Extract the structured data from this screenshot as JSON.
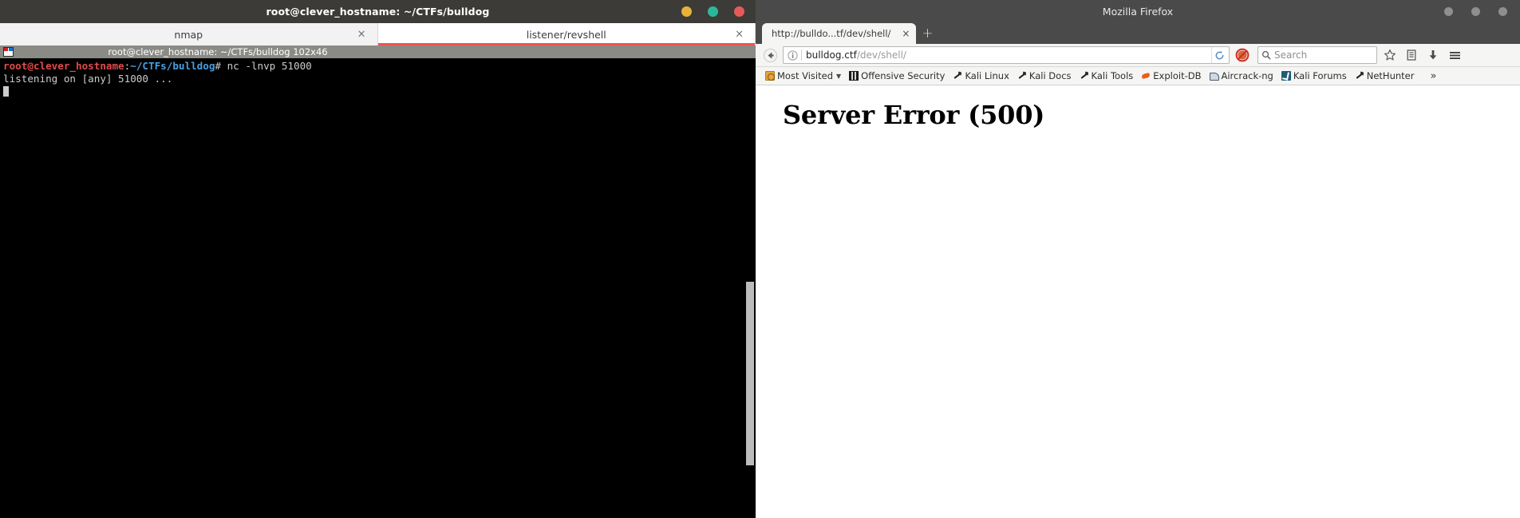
{
  "terminal": {
    "window_title": "root@clever_hostname: ~/CTFs/bulldog",
    "window_buttons": {
      "minimize": "minimize-circle",
      "maximize": "maximize-circle",
      "close": "close-circle",
      "minimize_color": "#e8b33a",
      "maximize_color": "#2bb89a",
      "close_color": "#e85a5a"
    },
    "tabs": [
      {
        "label": "nmap",
        "close": "×",
        "active": false
      },
      {
        "label": "listener/revshell",
        "close": "×",
        "active": true
      }
    ],
    "active_tab_accent": "#ef5350",
    "pane_title": "root@clever_hostname: ~/CTFs/bulldog 102x46",
    "pane_icon": "terminal-pane-icon",
    "prompt": {
      "user_host": "root@clever_hostname",
      "colon": ":",
      "path": "~/CTFs/bulldog",
      "sigil": "# ",
      "command": "nc -lnvp 51000"
    },
    "output_line": "listening on [any] 51000 ...",
    "colors": {
      "background": "#000000",
      "foreground": "#cccccc",
      "user_host": "#e04b4b",
      "path": "#4a9fe0"
    }
  },
  "firefox": {
    "window_title": "Mozilla Firefox",
    "window_buttons": {
      "minimize": "minimize-circle",
      "maximize": "maximize-circle",
      "close": "close-circle",
      "color": "#8f8f8f"
    },
    "tabs": [
      {
        "label": "http://bulldo...tf/dev/shell/",
        "close": "×",
        "active": true
      }
    ],
    "new_tab_label": "+",
    "navigation": {
      "back_icon": "back-arrow-icon",
      "identity_icon": "info-icon",
      "url_host": "bulldog.ctf",
      "url_path": "/dev/shell/",
      "url_full": "bulldog.ctf/dev/shell/",
      "reload_icon": "reload-icon",
      "noscript_icon": "noscript-blocked-icon",
      "search_placeholder": "Search",
      "search_icon": "search-icon",
      "bookmark_star_icon": "star-icon",
      "library_icon": "library-icon",
      "downloads_icon": "download-arrow-icon",
      "menu_icon": "hamburger-menu-icon"
    },
    "bookmarks": [
      {
        "label": "Most Visited",
        "icon": "most-visited-icon",
        "has_chevron": true
      },
      {
        "label": "Offensive Security",
        "icon": "offensive-security-icon",
        "has_chevron": false
      },
      {
        "label": "Kali Linux",
        "icon": "kali-dragon-icon",
        "has_chevron": false
      },
      {
        "label": "Kali Docs",
        "icon": "kali-dragon-icon",
        "has_chevron": false
      },
      {
        "label": "Kali Tools",
        "icon": "kali-dragon-icon",
        "has_chevron": false
      },
      {
        "label": "Exploit-DB",
        "icon": "exploit-db-icon",
        "has_chevron": false
      },
      {
        "label": "Aircrack-ng",
        "icon": "aircrack-ng-icon",
        "has_chevron": false
      },
      {
        "label": "Kali Forums",
        "icon": "kali-forums-icon",
        "has_chevron": false
      },
      {
        "label": "NetHunter",
        "icon": "kali-dragon-icon",
        "has_chevron": false
      }
    ],
    "bookmarks_overflow": "»",
    "page": {
      "heading": "Server Error (500)"
    }
  }
}
